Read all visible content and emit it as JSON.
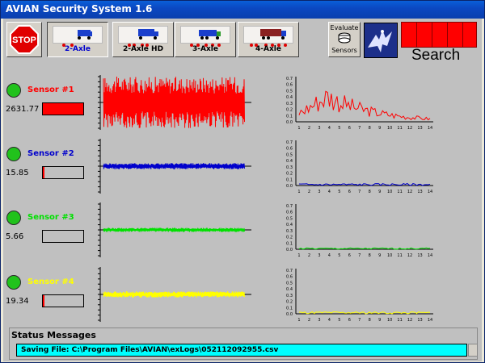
{
  "window": {
    "title": "AVIAN Security System 1.6"
  },
  "toolbar": {
    "stop_label": "STOP",
    "vehicles": [
      {
        "label": "2-Axle",
        "selected": true
      },
      {
        "label": "2-Axle HD",
        "selected": false
      },
      {
        "label": "3-Axle",
        "selected": false
      },
      {
        "label": "4-Axle",
        "selected": false
      }
    ],
    "evaluate_label_1": "Evaluate",
    "evaluate_label_2": "Sensors",
    "search_label": "Search"
  },
  "sensors": [
    {
      "name": "Sensor #1",
      "value": "2631.77",
      "color": "#ff0000",
      "level": 1.0,
      "amplitude": 1.0
    },
    {
      "name": "Sensor #2",
      "value": "15.85",
      "color": "#0000cc",
      "level": 0.04,
      "amplitude": 0.12
    },
    {
      "name": "Sensor #3",
      "value": "5.66",
      "color": "#00e000",
      "level": 0.0,
      "amplitude": 0.08
    },
    {
      "name": "Sensor #4",
      "value": "19.34",
      "color": "#ffff00",
      "level": 0.04,
      "amplitude": 0.12
    }
  ],
  "histogram": {
    "y_ticks": [
      "0.7",
      "0.6",
      "0.5",
      "0.4",
      "0.3",
      "0.2",
      "0.1",
      "0.0"
    ],
    "x_ticks": [
      "1",
      "2",
      "3",
      "4",
      "5",
      "6",
      "7",
      "8",
      "9",
      "10",
      "11",
      "12",
      "13",
      "14"
    ]
  },
  "status": {
    "title": "Status Messages",
    "message": "Saving File: C:\\Program Files\\AVIAN\\exLogs\\052112092955.csv"
  }
}
